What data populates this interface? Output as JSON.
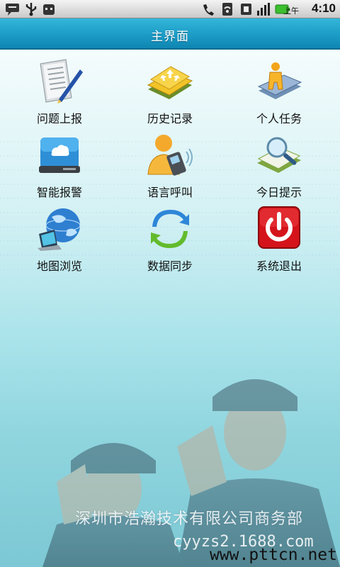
{
  "status_bar": {
    "ampm": "上午",
    "time": "4:10",
    "icons": [
      "message-icon",
      "usb-icon",
      "android-icon",
      "phone-icon",
      "wifi-icon",
      "sim-icon",
      "signal-icon",
      "battery-icon"
    ]
  },
  "title_bar": {
    "title": "主界面",
    "color": "#1b9cc7"
  },
  "menu": [
    {
      "label": "问题上报",
      "icon": "newspaper-pen-icon"
    },
    {
      "label": "历史记录",
      "icon": "book-arrows-icon"
    },
    {
      "label": "个人任务",
      "icon": "person-book-icon"
    },
    {
      "label": "智能报警",
      "icon": "cloud-drive-icon"
    },
    {
      "label": "语言呼叫",
      "icon": "person-phone-icon"
    },
    {
      "label": "今日提示",
      "icon": "book-magnifier-icon"
    },
    {
      "label": "地图浏览",
      "icon": "globe-laptop-icon"
    },
    {
      "label": "数据同步",
      "icon": "sync-icon"
    },
    {
      "label": "系统退出",
      "icon": "power-icon"
    }
  ],
  "watermark": {
    "company": "深圳市浩瀚技术有限公司商务部",
    "url1": "cyyzs2.1688.com",
    "url2": "www.pttcn.net"
  }
}
